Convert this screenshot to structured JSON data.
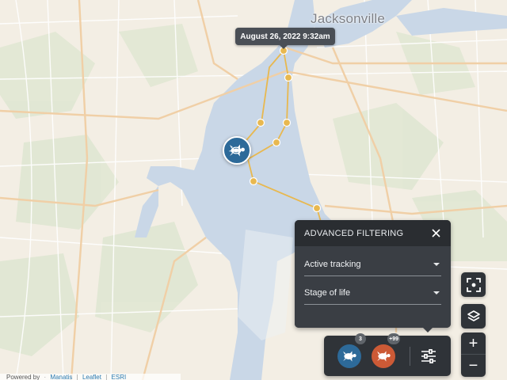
{
  "map": {
    "city_label": "Jacksonville",
    "colors": {
      "land": "#f3eee4",
      "water": "#c9d7e7",
      "park": "#dfe6d2",
      "road_major": "#f0cfa6",
      "road_minor": "#ffffff",
      "track": "#e8b84f"
    }
  },
  "tooltip": {
    "text": "August 26, 2022 9:32am"
  },
  "track_marker": {
    "icon": "sea-turtle-icon"
  },
  "filter_panel": {
    "title": "ADVANCED FILTERING",
    "close_icon": "close-icon",
    "dropdowns": [
      {
        "label": "Active tracking"
      },
      {
        "label": "Stage of life"
      }
    ]
  },
  "legend": {
    "groups": [
      {
        "icon": "sea-turtle-icon",
        "color": "#2d6a99",
        "badge": "3"
      },
      {
        "icon": "sea-turtle-icon",
        "color": "#cc5a36",
        "badge": "+99"
      }
    ],
    "filter_icon": "sliders-icon"
  },
  "controls": {
    "fit_icon": "focus-frame-icon",
    "layers_icon": "layers-icon",
    "zoom_in": "+",
    "zoom_out": "−"
  },
  "attribution": {
    "prefix": "Powered by",
    "links": [
      "Manatis",
      "Leaflet",
      "ESRI"
    ]
  }
}
